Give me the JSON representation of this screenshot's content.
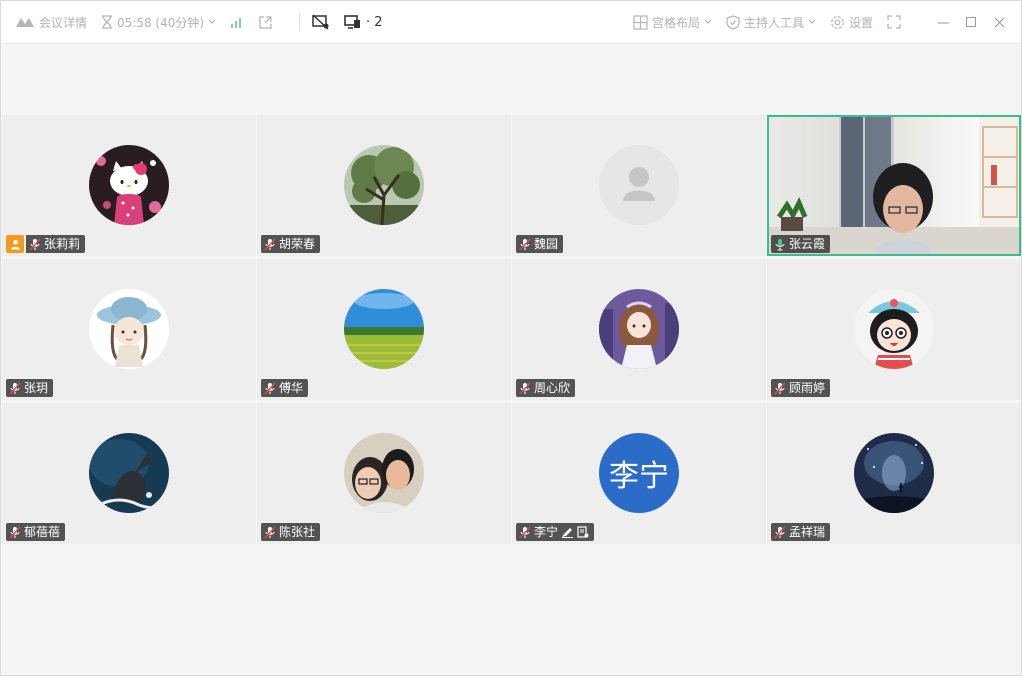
{
  "topbar": {
    "meeting_info": "会议详情",
    "timer": "05:58 (40分钟)",
    "share_count": "· 2",
    "layout": "宫格布局",
    "host_tools": "主持人工具",
    "settings": "设置"
  },
  "participants": [
    {
      "name": "张莉莉",
      "host": true,
      "avatar": "hello-kitty"
    },
    {
      "name": "胡荣春",
      "avatar": "tree"
    },
    {
      "name": "魏园",
      "avatar": "default"
    },
    {
      "name": "张云霞",
      "avatar": "video",
      "speaking": true
    },
    {
      "name": "张玥",
      "avatar": "girl-hat"
    },
    {
      "name": "傅华",
      "avatar": "field"
    },
    {
      "name": "周心欣",
      "avatar": "anime-girl"
    },
    {
      "name": "顾雨婷",
      "avatar": "cartoon-girl"
    },
    {
      "name": "郁蓓蓓",
      "avatar": "ocean"
    },
    {
      "name": "陈张社",
      "avatar": "couple"
    },
    {
      "name": "李宁",
      "avatar": "letter",
      "avatar_text": "李宁"
    },
    {
      "name": "孟祥瑞",
      "avatar": "night"
    }
  ],
  "colors": {
    "active_border": "#3dbd8f",
    "host_badge": "#f29a1f",
    "letter_avatar": "#2c6cc9"
  }
}
